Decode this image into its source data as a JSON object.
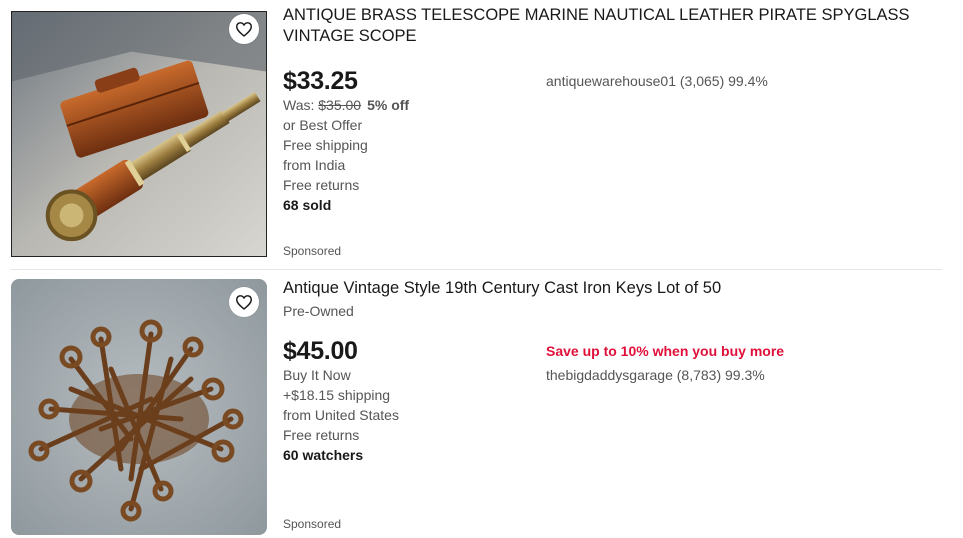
{
  "listings": [
    {
      "title": "ANTIQUE BRASS TELESCOPE MARINE NAUTICAL LEATHER PIRATE SPYGLASS VINTAGE SCOPE",
      "price": "$33.25",
      "was_label": "Was: ",
      "was_price": "$35.00",
      "discount": "5% off",
      "best_offer": "or Best Offer",
      "shipping": "Free shipping",
      "origin": "from India",
      "returns": "Free returns",
      "sold": "68 sold",
      "sponsored": "Sponsored",
      "seller": "antiquewarehouse01 (3,065) 99.4%",
      "image_icon": "telescope-photo"
    },
    {
      "title": "Antique Vintage Style 19th Century Cast Iron Keys Lot of 50",
      "condition": "Pre-Owned",
      "price": "$45.00",
      "buy_format": "Buy It Now",
      "shipping": "+$18.15 shipping",
      "origin": "from United States",
      "returns": "Free returns",
      "watchers": "60 watchers",
      "sponsored": "Sponsored",
      "promo": "Save up to 10% when you buy more",
      "seller": "thebigdaddysgarage (8,783) 99.3%",
      "image_icon": "keys-photo"
    }
  ],
  "colors": {
    "promo_red": "#e0103a",
    "text_dark": "#191919",
    "text_muted": "#555555",
    "divider": "#e5e5e5"
  },
  "icons": {
    "watch": "heart-icon"
  }
}
